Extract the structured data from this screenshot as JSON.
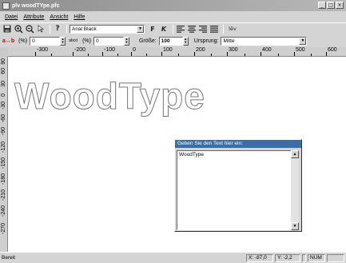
{
  "window": {
    "title": "plv woodTYpe.pfc",
    "minimize": "_",
    "maximize": "□",
    "close": "×"
  },
  "menu": [
    "Datei",
    "Attribute",
    "Ansicht",
    "Hilfe"
  ],
  "toolbar1": {
    "font_name": "Arial Black",
    "bold_label": "F",
    "italic_label": "K",
    "text_tool": "lēv"
  },
  "toolbar2": {
    "char_spacing_icon": "a↔b",
    "char_spacing_unit": "(%)",
    "char_spacing_value": "0",
    "line_spacing_icon": "abcd",
    "line_spacing_unit": "(%)",
    "line_spacing_value": "0",
    "size_label": "Größe:",
    "size_value": "100",
    "origin_label": "Ursprung:",
    "origin_value": "Mitte"
  },
  "hruler": [
    "-300",
    "-200",
    "-100",
    "0",
    "100",
    "200",
    "300",
    "400",
    "500",
    "600"
  ],
  "vruler": [
    "90",
    "60",
    "30",
    "0",
    "-30",
    "-60",
    "-90",
    "-120",
    "-150",
    "-180",
    "-210",
    "-240",
    "-270"
  ],
  "canvas": {
    "text": "WoodType"
  },
  "dialog": {
    "title": "Geben Sie den Text hier ein:",
    "text": "WoodType"
  },
  "status": {
    "ready": "Bereit",
    "x": "X: -87,0",
    "y": "Y: -2,2",
    "num": "NUM"
  }
}
